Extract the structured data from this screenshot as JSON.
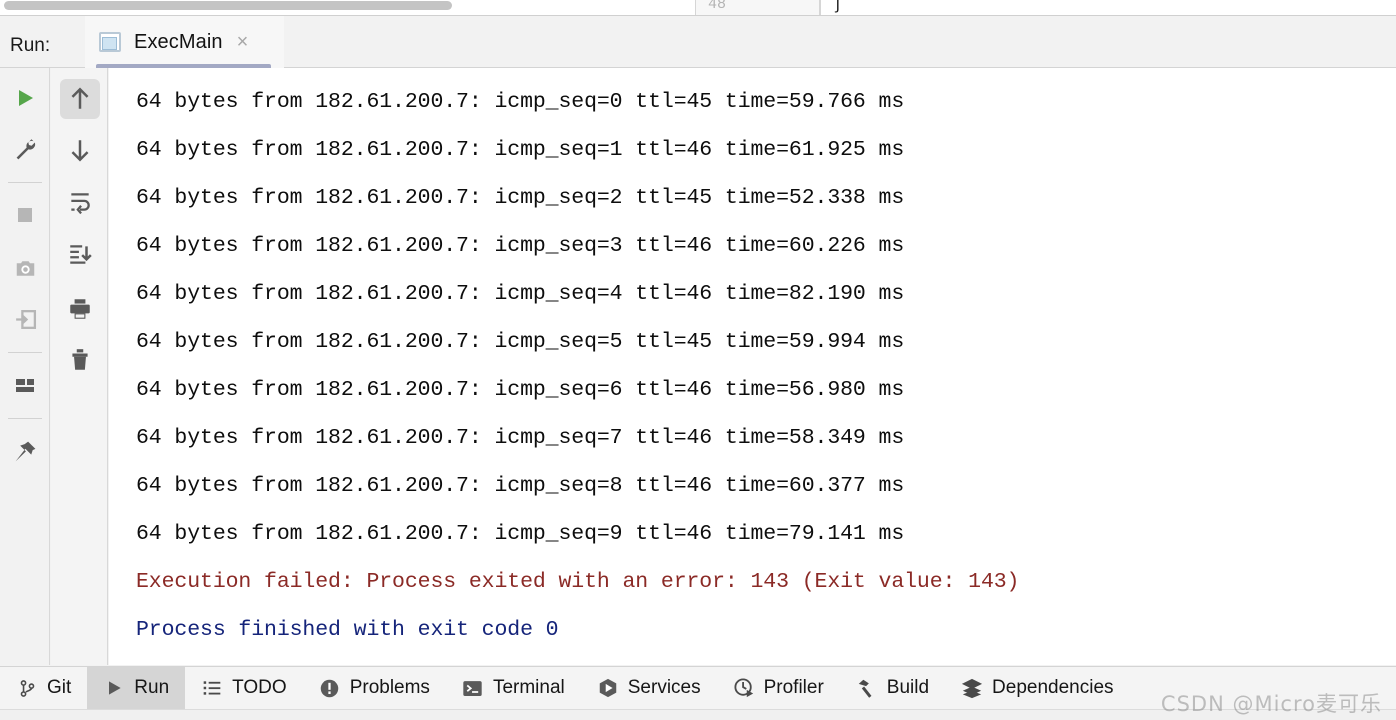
{
  "editor_strip": {
    "clipped_number": "48",
    "clipped_glyph": "∫"
  },
  "run_header": {
    "label": "Run:",
    "tab": {
      "icon": "console-window-icon",
      "title": "ExecMain",
      "close": "×"
    }
  },
  "left_rail": {
    "primary": [
      {
        "name": "rerun-button",
        "icon": "play-green-icon"
      },
      {
        "name": "edit-configuration-button",
        "icon": "wrench-icon"
      },
      {
        "name": "stop-button",
        "icon": "stop-square-icon"
      },
      {
        "name": "screenshot-button",
        "icon": "camera-icon"
      },
      {
        "name": "attach-console-button",
        "icon": "enter-arrow-icon"
      },
      {
        "name": "layout-button",
        "icon": "layout-grid-icon"
      },
      {
        "name": "pin-tab-button",
        "icon": "pin-icon"
      }
    ],
    "secondary": [
      {
        "name": "scroll-up-button",
        "icon": "arrow-up-icon",
        "active": true
      },
      {
        "name": "scroll-down-button",
        "icon": "arrow-down-icon",
        "active": false
      },
      {
        "name": "soft-wrap-button",
        "icon": "soft-wrap-icon",
        "active": false
      },
      {
        "name": "scroll-to-end-button",
        "icon": "scroll-to-end-icon",
        "active": false
      },
      {
        "name": "print-button",
        "icon": "printer-icon",
        "active": false
      },
      {
        "name": "clear-all-button",
        "icon": "trash-icon",
        "active": false
      }
    ]
  },
  "console": {
    "lines": [
      {
        "text": "64 bytes from 182.61.200.7: icmp_seq=0 ttl=45 time=59.766 ms",
        "style": "normal"
      },
      {
        "text": "64 bytes from 182.61.200.7: icmp_seq=1 ttl=46 time=61.925 ms",
        "style": "normal"
      },
      {
        "text": "64 bytes from 182.61.200.7: icmp_seq=2 ttl=45 time=52.338 ms",
        "style": "normal"
      },
      {
        "text": "64 bytes from 182.61.200.7: icmp_seq=3 ttl=46 time=60.226 ms",
        "style": "normal"
      },
      {
        "text": "64 bytes from 182.61.200.7: icmp_seq=4 ttl=46 time=82.190 ms",
        "style": "normal"
      },
      {
        "text": "64 bytes from 182.61.200.7: icmp_seq=5 ttl=45 time=59.994 ms",
        "style": "normal"
      },
      {
        "text": "64 bytes from 182.61.200.7: icmp_seq=6 ttl=46 time=56.980 ms",
        "style": "normal"
      },
      {
        "text": "64 bytes from 182.61.200.7: icmp_seq=7 ttl=46 time=58.349 ms",
        "style": "normal"
      },
      {
        "text": "64 bytes from 182.61.200.7: icmp_seq=8 ttl=46 time=60.377 ms",
        "style": "normal"
      },
      {
        "text": "64 bytes from 182.61.200.7: icmp_seq=9 ttl=46 time=79.141 ms",
        "style": "normal"
      },
      {
        "text": "Execution failed: Process exited with an error: 143 (Exit value: 143)",
        "style": "error"
      },
      {
        "text": "",
        "style": "normal"
      },
      {
        "text": "Process finished with exit code 0",
        "style": "success"
      }
    ]
  },
  "statusbar": {
    "items": [
      {
        "label": "Git",
        "icon": "git-branch-icon",
        "selected": false
      },
      {
        "label": "Run",
        "icon": "play-icon",
        "selected": true
      },
      {
        "label": "TODO",
        "icon": "list-icon",
        "selected": false
      },
      {
        "label": "Problems",
        "icon": "exclamation-circle-icon",
        "selected": false
      },
      {
        "label": "Terminal",
        "icon": "terminal-prompt-icon",
        "selected": false
      },
      {
        "label": "Services",
        "icon": "hexagon-play-icon",
        "selected": false
      },
      {
        "label": "Profiler",
        "icon": "clock-play-icon",
        "selected": false
      },
      {
        "label": "Build",
        "icon": "hammer-icon",
        "selected": false
      },
      {
        "label": "Dependencies",
        "icon": "layers-icon",
        "selected": false
      }
    ]
  },
  "watermark": {
    "text": "CSDN @Micro麦可乐"
  },
  "colors": {
    "error_text": "#8b2a26",
    "success_text": "#15247a",
    "console_bg": "#ffffff",
    "chrome_bg": "#f2f2f2",
    "tab_underline": "#a3a9c4",
    "run_green": "#56a64b"
  }
}
